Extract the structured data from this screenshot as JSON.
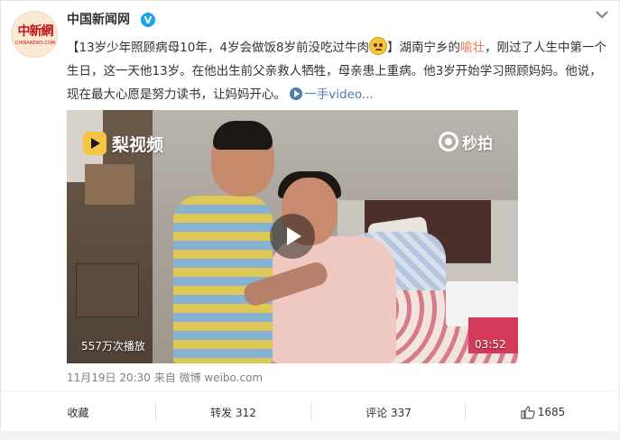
{
  "account": {
    "name": "中国新闻网",
    "avatar_logo": "中新網",
    "avatar_sub": "CHINANEWS.COM",
    "verified_mark": "V"
  },
  "post": {
    "text_part1": "【13岁少年照顾病母10年，4岁会做饭8岁前没吃过牛肉",
    "text_part2": "】湖南宁乡的",
    "highlight": "喻壮",
    "text_part3": "，刚过了人生中第一个生日，这一天他13岁。在他出生前父亲救人牺牲，母亲患上重病。他3岁开始学习照顾妈妈。他说，现在最大心愿是努力读书，让妈妈开心。",
    "video_link": "一手video..."
  },
  "video": {
    "logo_text": "梨视频",
    "watermark": "秒拍",
    "views": "557万次播放",
    "duration": "03:52"
  },
  "meta": {
    "text": "11月19日 20:30 来自 微博 weibo.com"
  },
  "footer": {
    "collect": "收藏",
    "repost": "转发 312",
    "comment": "评论 337",
    "like": "1685"
  },
  "colors": {
    "accent": "#eb7350",
    "link": "#507daf",
    "verified": "#1da2f2"
  },
  "icons": [
    "chevron-down-icon",
    "verified-icon",
    "emoji-sad-icon",
    "video-link-icon",
    "play-icon",
    "pear-video-logo-icon",
    "miaopai-icon",
    "thumb-up-icon"
  ]
}
